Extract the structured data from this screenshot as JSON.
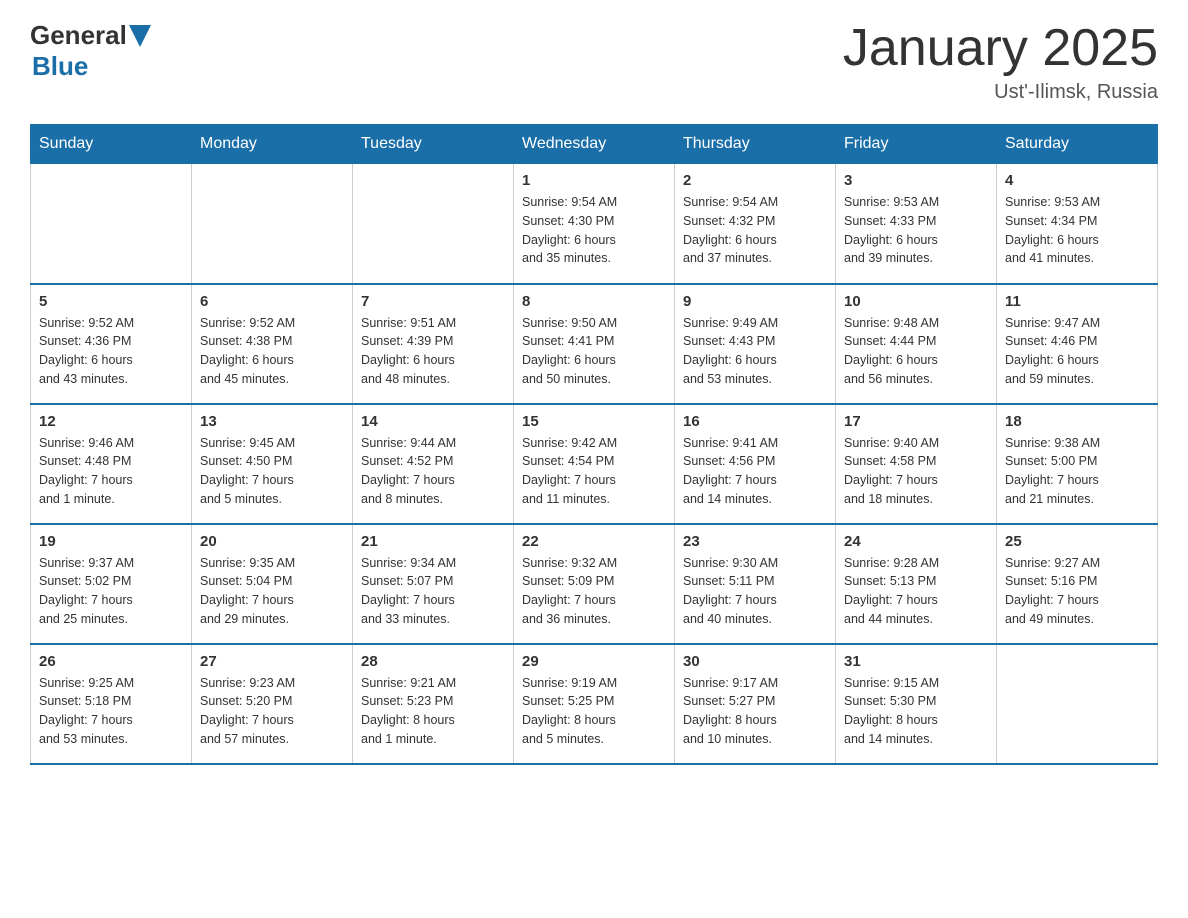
{
  "header": {
    "logo": {
      "general": "General",
      "blue": "Blue",
      "triangle": "▶"
    },
    "title": "January 2025",
    "location": "Ust'-Ilimsk, Russia"
  },
  "days_of_week": [
    "Sunday",
    "Monday",
    "Tuesday",
    "Wednesday",
    "Thursday",
    "Friday",
    "Saturday"
  ],
  "weeks": [
    [
      {
        "day": "",
        "info": ""
      },
      {
        "day": "",
        "info": ""
      },
      {
        "day": "",
        "info": ""
      },
      {
        "day": "1",
        "info": "Sunrise: 9:54 AM\nSunset: 4:30 PM\nDaylight: 6 hours\nand 35 minutes."
      },
      {
        "day": "2",
        "info": "Sunrise: 9:54 AM\nSunset: 4:32 PM\nDaylight: 6 hours\nand 37 minutes."
      },
      {
        "day": "3",
        "info": "Sunrise: 9:53 AM\nSunset: 4:33 PM\nDaylight: 6 hours\nand 39 minutes."
      },
      {
        "day": "4",
        "info": "Sunrise: 9:53 AM\nSunset: 4:34 PM\nDaylight: 6 hours\nand 41 minutes."
      }
    ],
    [
      {
        "day": "5",
        "info": "Sunrise: 9:52 AM\nSunset: 4:36 PM\nDaylight: 6 hours\nand 43 minutes."
      },
      {
        "day": "6",
        "info": "Sunrise: 9:52 AM\nSunset: 4:38 PM\nDaylight: 6 hours\nand 45 minutes."
      },
      {
        "day": "7",
        "info": "Sunrise: 9:51 AM\nSunset: 4:39 PM\nDaylight: 6 hours\nand 48 minutes."
      },
      {
        "day": "8",
        "info": "Sunrise: 9:50 AM\nSunset: 4:41 PM\nDaylight: 6 hours\nand 50 minutes."
      },
      {
        "day": "9",
        "info": "Sunrise: 9:49 AM\nSunset: 4:43 PM\nDaylight: 6 hours\nand 53 minutes."
      },
      {
        "day": "10",
        "info": "Sunrise: 9:48 AM\nSunset: 4:44 PM\nDaylight: 6 hours\nand 56 minutes."
      },
      {
        "day": "11",
        "info": "Sunrise: 9:47 AM\nSunset: 4:46 PM\nDaylight: 6 hours\nand 59 minutes."
      }
    ],
    [
      {
        "day": "12",
        "info": "Sunrise: 9:46 AM\nSunset: 4:48 PM\nDaylight: 7 hours\nand 1 minute."
      },
      {
        "day": "13",
        "info": "Sunrise: 9:45 AM\nSunset: 4:50 PM\nDaylight: 7 hours\nand 5 minutes."
      },
      {
        "day": "14",
        "info": "Sunrise: 9:44 AM\nSunset: 4:52 PM\nDaylight: 7 hours\nand 8 minutes."
      },
      {
        "day": "15",
        "info": "Sunrise: 9:42 AM\nSunset: 4:54 PM\nDaylight: 7 hours\nand 11 minutes."
      },
      {
        "day": "16",
        "info": "Sunrise: 9:41 AM\nSunset: 4:56 PM\nDaylight: 7 hours\nand 14 minutes."
      },
      {
        "day": "17",
        "info": "Sunrise: 9:40 AM\nSunset: 4:58 PM\nDaylight: 7 hours\nand 18 minutes."
      },
      {
        "day": "18",
        "info": "Sunrise: 9:38 AM\nSunset: 5:00 PM\nDaylight: 7 hours\nand 21 minutes."
      }
    ],
    [
      {
        "day": "19",
        "info": "Sunrise: 9:37 AM\nSunset: 5:02 PM\nDaylight: 7 hours\nand 25 minutes."
      },
      {
        "day": "20",
        "info": "Sunrise: 9:35 AM\nSunset: 5:04 PM\nDaylight: 7 hours\nand 29 minutes."
      },
      {
        "day": "21",
        "info": "Sunrise: 9:34 AM\nSunset: 5:07 PM\nDaylight: 7 hours\nand 33 minutes."
      },
      {
        "day": "22",
        "info": "Sunrise: 9:32 AM\nSunset: 5:09 PM\nDaylight: 7 hours\nand 36 minutes."
      },
      {
        "day": "23",
        "info": "Sunrise: 9:30 AM\nSunset: 5:11 PM\nDaylight: 7 hours\nand 40 minutes."
      },
      {
        "day": "24",
        "info": "Sunrise: 9:28 AM\nSunset: 5:13 PM\nDaylight: 7 hours\nand 44 minutes."
      },
      {
        "day": "25",
        "info": "Sunrise: 9:27 AM\nSunset: 5:16 PM\nDaylight: 7 hours\nand 49 minutes."
      }
    ],
    [
      {
        "day": "26",
        "info": "Sunrise: 9:25 AM\nSunset: 5:18 PM\nDaylight: 7 hours\nand 53 minutes."
      },
      {
        "day": "27",
        "info": "Sunrise: 9:23 AM\nSunset: 5:20 PM\nDaylight: 7 hours\nand 57 minutes."
      },
      {
        "day": "28",
        "info": "Sunrise: 9:21 AM\nSunset: 5:23 PM\nDaylight: 8 hours\nand 1 minute."
      },
      {
        "day": "29",
        "info": "Sunrise: 9:19 AM\nSunset: 5:25 PM\nDaylight: 8 hours\nand 5 minutes."
      },
      {
        "day": "30",
        "info": "Sunrise: 9:17 AM\nSunset: 5:27 PM\nDaylight: 8 hours\nand 10 minutes."
      },
      {
        "day": "31",
        "info": "Sunrise: 9:15 AM\nSunset: 5:30 PM\nDaylight: 8 hours\nand 14 minutes."
      },
      {
        "day": "",
        "info": ""
      }
    ]
  ]
}
